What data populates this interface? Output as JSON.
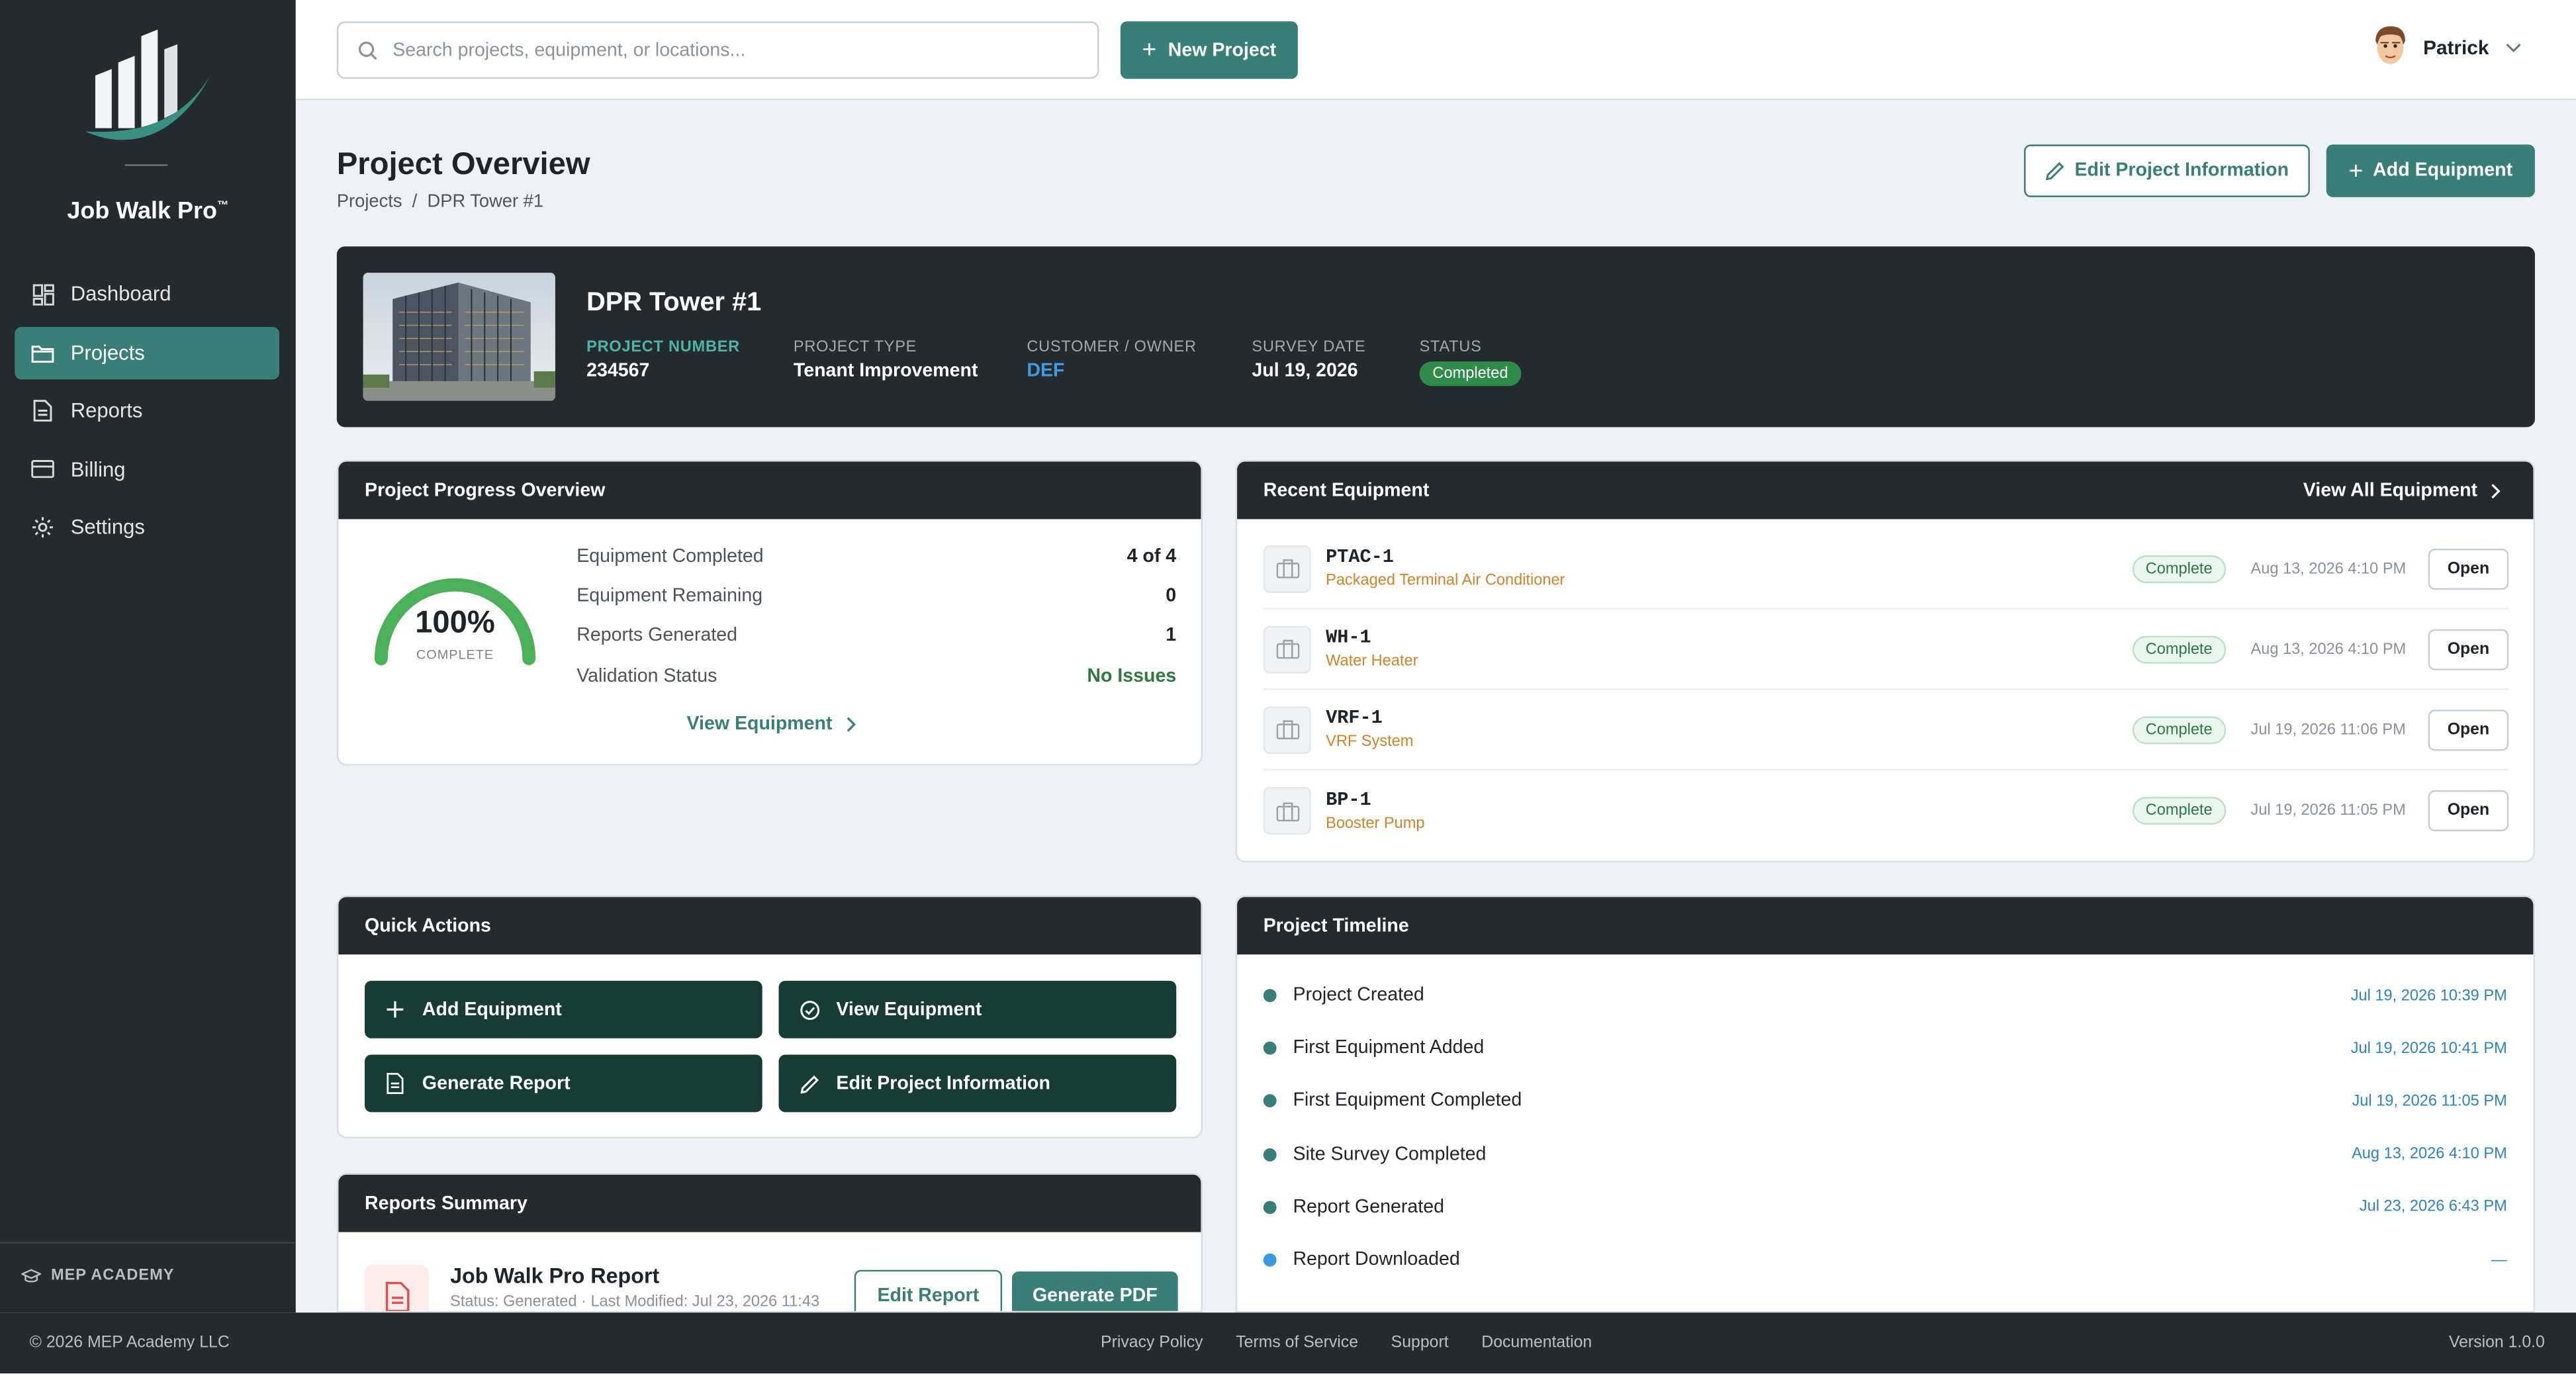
{
  "app": {
    "name": "Job Walk Pro",
    "trademark": "™",
    "academy_label": "MEP ACADEMY"
  },
  "sidebar": {
    "items": [
      {
        "label": "Dashboard",
        "icon": "dashboard-grid-icon",
        "active": false
      },
      {
        "label": "Projects",
        "icon": "folder-icon",
        "active": true
      },
      {
        "label": "Reports",
        "icon": "document-icon",
        "active": false
      },
      {
        "label": "Billing",
        "icon": "credit-card-icon",
        "active": false
      },
      {
        "label": "Settings",
        "icon": "gear-icon",
        "active": false
      }
    ]
  },
  "topbar": {
    "search_placeholder": "Search projects, equipment, or locations...",
    "new_project_label": "New Project",
    "user_name": "Patrick"
  },
  "page": {
    "title": "Project Overview",
    "breadcrumb": {
      "root": "Projects",
      "separator": "/",
      "current": "DPR Tower #1"
    },
    "edit_info_label": "Edit Project Information",
    "add_equipment_label": "Add Equipment"
  },
  "project": {
    "name": "DPR Tower #1",
    "number_label": "PROJECT NUMBER",
    "number": "234567",
    "type_label": "PROJECT TYPE",
    "type": "Tenant Improvement",
    "customer_label": "CUSTOMER / OWNER",
    "customer": "DEF",
    "survey_label": "SURVEY DATE",
    "survey_date": "Jul 19, 2026",
    "status_label": "STATUS",
    "status": "Completed"
  },
  "progress": {
    "title": "Project Progress Overview",
    "percent": 100,
    "percent_text": "100%",
    "percent_caption": "COMPLETE",
    "stats": [
      {
        "label": "Equipment Completed",
        "value": "4 of 4"
      },
      {
        "label": "Equipment Remaining",
        "value": "0"
      },
      {
        "label": "Reports Generated",
        "value": "1"
      },
      {
        "label": "Validation Status",
        "value": "No Issues"
      }
    ],
    "view_link": "View Equipment"
  },
  "recent_equipment": {
    "title": "Recent Equipment",
    "view_all": "View All Equipment",
    "items": [
      {
        "code": "PTAC-1",
        "type": "Packaged Terminal Air Conditioner",
        "status": "Complete",
        "date": "Aug 13, 2026 4:10 PM",
        "action": "Open"
      },
      {
        "code": "WH-1",
        "type": "Water Heater",
        "status": "Complete",
        "date": "Aug 13, 2026 4:10 PM",
        "action": "Open"
      },
      {
        "code": "VRF-1",
        "type": "VRF System",
        "status": "Complete",
        "date": "Jul 19, 2026 11:06 PM",
        "action": "Open"
      },
      {
        "code": "BP-1",
        "type": "Booster Pump",
        "status": "Complete",
        "date": "Jul 19, 2026 11:05 PM",
        "action": "Open"
      }
    ]
  },
  "quick_actions": {
    "title": "Quick Actions",
    "buttons": [
      {
        "label": "Add Equipment",
        "icon": "plus-icon"
      },
      {
        "label": "View Equipment",
        "icon": "check-circle-icon"
      },
      {
        "label": "Generate Report",
        "icon": "document-icon"
      },
      {
        "label": "Edit Project Information",
        "icon": "pencil-icon"
      }
    ]
  },
  "timeline": {
    "title": "Project Timeline",
    "events": [
      {
        "label": "Project Created",
        "date": "Jul 19, 2026 10:39 PM"
      },
      {
        "label": "First Equipment Added",
        "date": "Jul 19, 2026 10:41 PM"
      },
      {
        "label": "First Equipment Completed",
        "date": "Jul 19, 2026 11:05 PM"
      },
      {
        "label": "Site Survey Completed",
        "date": "Aug 13, 2026 4:10 PM"
      },
      {
        "label": "Report Generated",
        "date": "Jul 23, 2026 6:43 PM"
      },
      {
        "label": "Report Downloaded",
        "date": "—"
      }
    ]
  },
  "reports": {
    "title": "Reports Summary",
    "report_title": "Job Walk Pro Report",
    "report_status": "Status: Generated · Last Modified: Jul 23, 2026 11:43",
    "edit_label": "Edit Report",
    "pdf_label": "Generate PDF"
  },
  "footer": {
    "copyright": "© 2026 MEP Academy LLC",
    "links": [
      "Privacy Policy",
      "Terms of Service",
      "Support",
      "Documentation"
    ],
    "version": "Version 1.0.0"
  },
  "colors": {
    "accent": "#3a7f77",
    "sidebar": "#242a2e",
    "action_dark": "#173b35",
    "equipment_type": "#d4822a",
    "status_green": "#2e8b4a",
    "link_blue": "#2e83c7"
  }
}
